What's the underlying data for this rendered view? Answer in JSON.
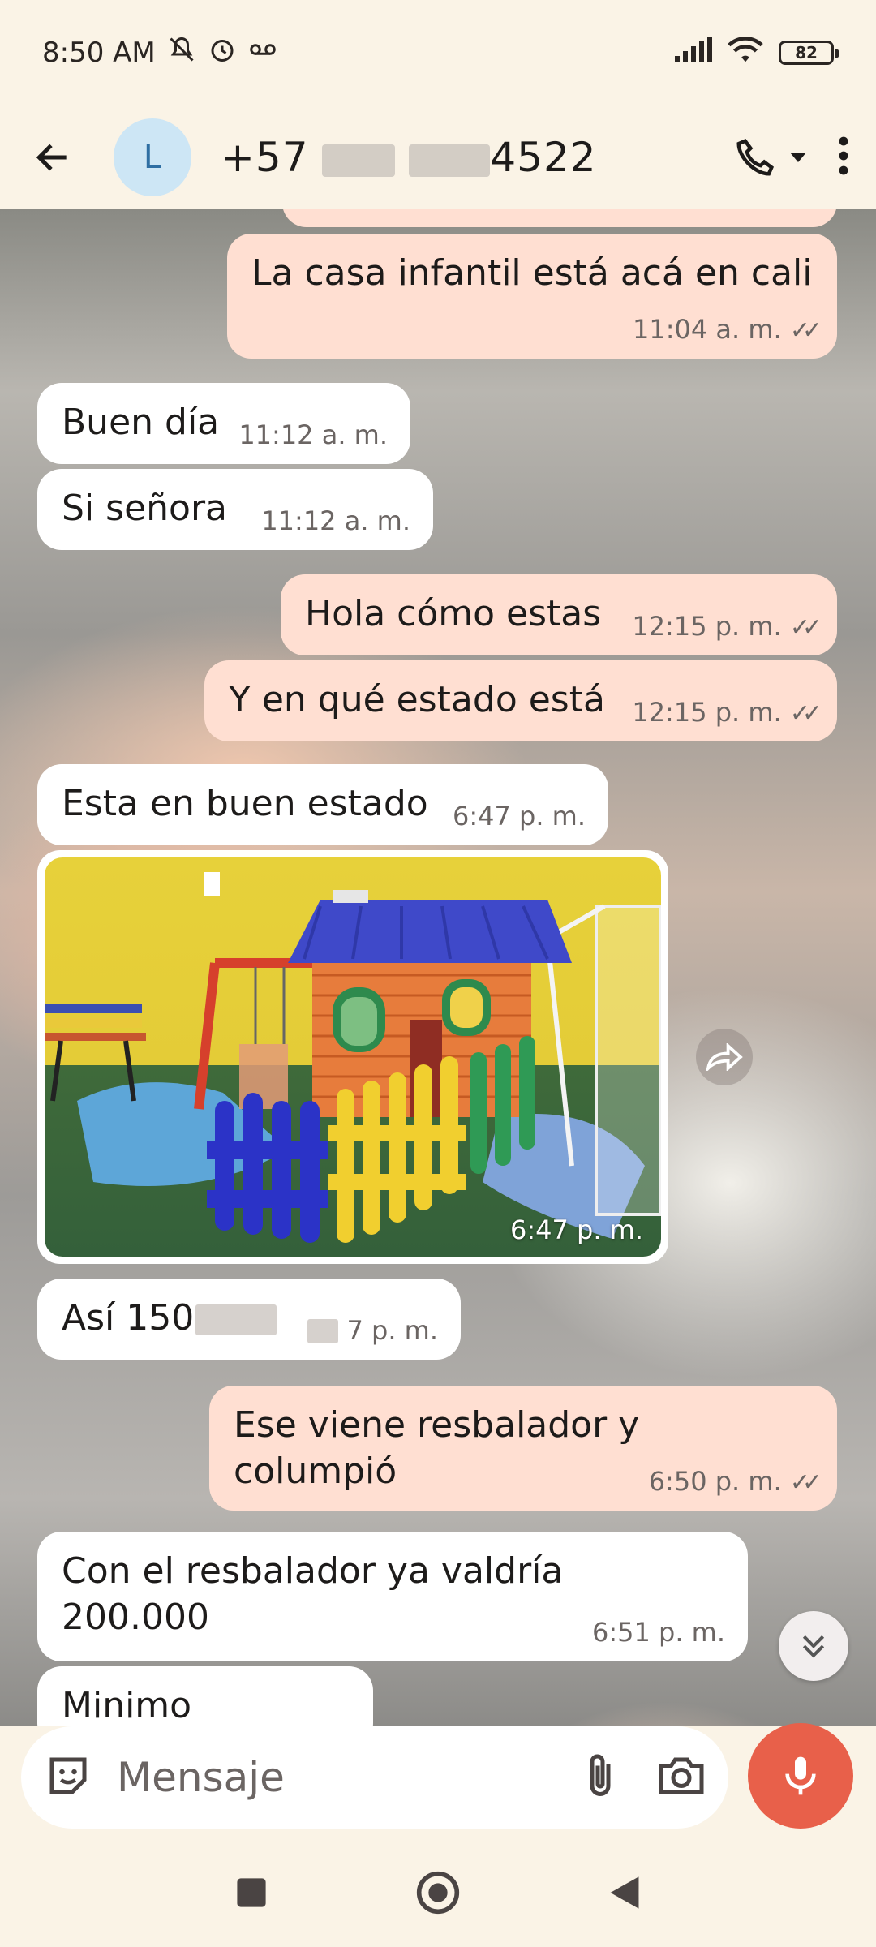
{
  "status_bar": {
    "time": "8:50 AM",
    "battery": "82"
  },
  "header": {
    "avatar_letter": "L",
    "contact_prefix": "+57 ",
    "contact_suffix": "4522"
  },
  "messages": [
    {
      "type": "out",
      "text": "La casa infantil está acá en cali",
      "time": "11:04 a. m.",
      "ticks": "✓✓"
    },
    {
      "type": "in",
      "text": "Buen día",
      "time": "11:12 a. m."
    },
    {
      "type": "in",
      "text": "Si señora",
      "time": "11:12 a. m."
    },
    {
      "type": "out",
      "text": "Hola cómo estas",
      "time": "12:15 p. m.",
      "ticks": "✓✓"
    },
    {
      "type": "out",
      "text": "Y en qué estado está",
      "time": "12:15 p. m.",
      "ticks": "✓✓"
    },
    {
      "type": "in",
      "text": "Esta en buen estado",
      "time": "6:47 p. m."
    },
    {
      "type": "in-photo",
      "time": "6:47 p. m."
    },
    {
      "type": "in",
      "text": "Así 150",
      "time": "7 p. m."
    },
    {
      "type": "out",
      "text": "Ese viene resbalador y columpió",
      "time": "6:50 p. m.",
      "ticks": "✓✓"
    },
    {
      "type": "in",
      "text": "Con el resbalador ya valdría 200.000",
      "time": "6:51 p. m."
    },
    {
      "type": "in",
      "text": "Minimo",
      "time": ""
    }
  ],
  "composer": {
    "placeholder": "Mensaje"
  },
  "colors": {
    "incoming_bubble": "#ffffff",
    "outgoing_bubble": "#ffdfd2",
    "mic_button": "#e8604a",
    "background": "#faf3e6"
  }
}
